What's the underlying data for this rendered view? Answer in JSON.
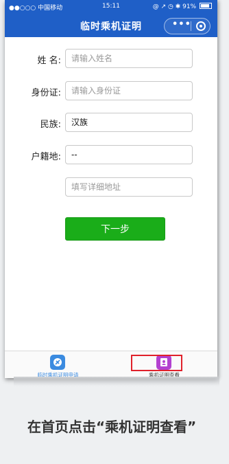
{
  "status_bar": {
    "signal": "●●○○○ 中国移动",
    "time": "15:11",
    "battery": "91%"
  },
  "header": {
    "title": "临时乘机证明",
    "more_icon": "ellipsis-icon",
    "close_icon": "target-circle-icon"
  },
  "form": {
    "name_label": "姓 名:",
    "name_placeholder": "请输入姓名",
    "id_label": "身份证:",
    "id_placeholder": "请输入身份证",
    "ethnic_label": "民族:",
    "ethnic_value": "汉族",
    "domicile_label": "户籍地:",
    "domicile_value": "--",
    "address_placeholder": "填写详细地址",
    "next_button": "下一步"
  },
  "tabbar": {
    "items": [
      {
        "label": "临时乘机证明申请",
        "icon": "airplane-icon",
        "color": "#3b8be0"
      },
      {
        "label": "乘机证明查看",
        "icon": "id-card-icon",
        "color": "#b341d0"
      }
    ]
  },
  "caption": "在首页点击“乘机证明查看”",
  "colors": {
    "header": "#1f5fc7",
    "primary_button": "#1aad19",
    "highlight": "#e0202a"
  }
}
